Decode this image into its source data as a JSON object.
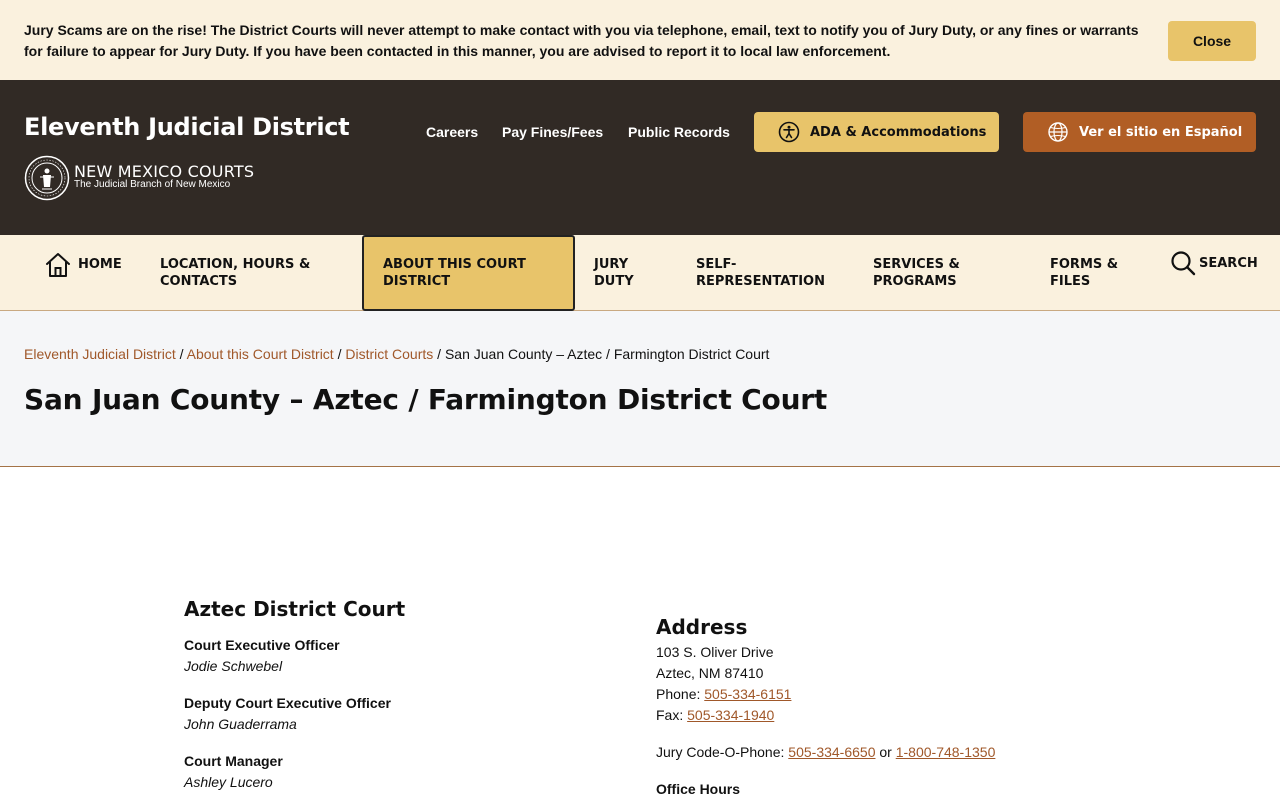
{
  "alert": {
    "message": "Jury Scams are on the rise! The District Courts will never attempt to make contact with you via telephone, email, text to notify you of Jury Duty, or any fines or warrants for failure to appear for Jury Duty. If you have been contacted in this manner, you are advised to report it to local law enforcement.",
    "close_label": "Close"
  },
  "header": {
    "site_title": "Eleventh Judicial District",
    "logo_main": "NEW MEXICO COURTS",
    "logo_sub": "The Judicial Branch of New Mexico",
    "links": [
      {
        "label": "Careers"
      },
      {
        "label": "Pay Fines/Fees"
      },
      {
        "label": "Public Records"
      }
    ],
    "ada_label": "ADA & Accommodations",
    "spanish_label": "Ver el sitio en Español"
  },
  "nav": {
    "home": "HOME",
    "location": [
      "LOCATION, HOURS &",
      "CONTACTS"
    ],
    "about": [
      "ABOUT THIS COURT",
      "DISTRICT"
    ],
    "jury": [
      "JURY",
      "DUTY"
    ],
    "self_rep": [
      "SELF-",
      "REPRESENTATION"
    ],
    "services": [
      "SERVICES &",
      "PROGRAMS"
    ],
    "forms": [
      "FORMS &",
      "FILES"
    ],
    "search": "SEARCH"
  },
  "breadcrumb": {
    "items": [
      "Eleventh Judicial District",
      "About this Court District",
      "District Courts"
    ],
    "current": "San Juan County – Aztec / Farmington District Court"
  },
  "page_title": "San Juan County – Aztec / Farmington District Court",
  "court": {
    "heading": "Aztec District Court",
    "staff": [
      {
        "role": "Court Executive Officer",
        "name": "Jodie Schwebel"
      },
      {
        "role": "Deputy Court Executive Officer",
        "name": "John Guaderrama"
      },
      {
        "role": "Court Manager",
        "name": "Ashley Lucero"
      }
    ]
  },
  "address": {
    "heading": "Address",
    "street": "103 S. Oliver Drive",
    "city": "Aztec, NM 87410",
    "phone_label": "Phone: ",
    "phone": "505-334-6151",
    "fax_label": "Fax: ",
    "fax": "505-334-1940",
    "jury_label": "Jury Code-O-Phone: ",
    "jury_phone": "505-334-6650",
    "or": " or ",
    "jury_tollfree": "1-800-748-1350",
    "hours_heading": "Office Hours"
  },
  "colors": {
    "header_bg": "#312a25",
    "cream": "#faf1de",
    "gold": "#e8c46a",
    "orange": "#b15e25",
    "link": "#a0582a"
  }
}
